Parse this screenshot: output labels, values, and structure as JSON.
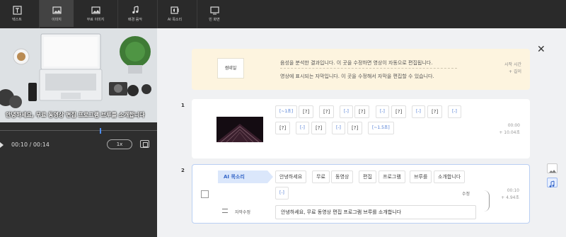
{
  "toolbar": {
    "items": [
      {
        "label": "텍스트",
        "icon": "text-icon"
      },
      {
        "label": "이미지",
        "icon": "image-icon"
      },
      {
        "label": "무료 이미지",
        "icon": "free-image-icon"
      },
      {
        "label": "배경 음악",
        "icon": "music-icon"
      },
      {
        "label": "AI 목소리",
        "icon": "ai-voice-icon"
      },
      {
        "label": "빈 화면",
        "icon": "blank-screen-icon"
      }
    ],
    "selected_index": 1
  },
  "player": {
    "caption": "안녕하세요, 무료 동영상 편집 프로그램 브루를 소개합니다",
    "time": "00:10 / 00:14",
    "speed": "1x",
    "progress": 0.64
  },
  "hint": {
    "thumb_label": "썸네일",
    "line1": "음성을 분석한 결과입니다. 이 곳을 수정하면 영상이 자동으로 편집됩니다.",
    "line2": "영상에 표시되는 자막입니다. 이 곳을 수정해서 자막을 편집할 수 있습니다.",
    "start_label": "시작 시간",
    "length_label": "+ 길이"
  },
  "rows": [
    {
      "number": "1",
      "chips_line1": [
        "[~1초]",
        "[?]",
        "[?]",
        "[-]",
        "[?]",
        "[-]",
        "[?]",
        "[-]",
        "[?]",
        "[-]"
      ],
      "chips_line2": [
        "[?]",
        "[-]",
        "[?]",
        "[-]",
        "[?]",
        "[~1.5초]"
      ],
      "time": "00:00",
      "duration": "+ 10.04초"
    },
    {
      "number": "2",
      "tag": "AI 목소리",
      "chips_line1": [
        "안녕하세요",
        "무료",
        "동영상",
        "편집",
        "프로그램",
        "브루를",
        "소개합니다"
      ],
      "chips_line2": [
        "[-]"
      ],
      "fix_label": "수정",
      "subtitle_label": "자막수정",
      "subtitle_text": "안녕하세요, 무료 동영상 편집 프로그램 브루를 소개합니다",
      "time": "00:10",
      "duration": "+ 4.94초"
    }
  ],
  "colors": {
    "accent": "#4d8df0",
    "hint_bg": "#fdf4df",
    "tag_bg": "#dbe7fb"
  }
}
